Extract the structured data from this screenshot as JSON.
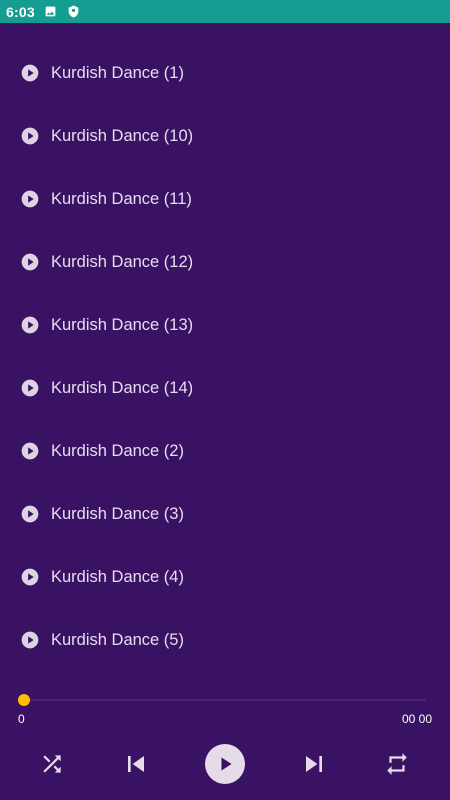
{
  "status_bar": {
    "time": "6:03",
    "icons": [
      "image-icon",
      "shield-icon"
    ],
    "background": "#139e91"
  },
  "tracks": [
    {
      "title": "Kurdish Dance (1)"
    },
    {
      "title": "Kurdish Dance (10)"
    },
    {
      "title": "Kurdish Dance (11)"
    },
    {
      "title": "Kurdish Dance (12)"
    },
    {
      "title": "Kurdish Dance (13)"
    },
    {
      "title": "Kurdish Dance (14)"
    },
    {
      "title": "Kurdish Dance (2)"
    },
    {
      "title": "Kurdish Dance (3)"
    },
    {
      "title": "Kurdish Dance (4)"
    },
    {
      "title": "Kurdish Dance (5)"
    }
  ],
  "player": {
    "position_label": "0",
    "duration_label": "00 00",
    "progress": 0,
    "controls": [
      "shuffle-icon",
      "previous-icon",
      "play-icon",
      "next-icon",
      "repeat-icon"
    ]
  },
  "colors": {
    "background": "#3a1263",
    "accent": "#ffbe00",
    "text": "#e8dcf1",
    "icon": "#e6dce9"
  }
}
